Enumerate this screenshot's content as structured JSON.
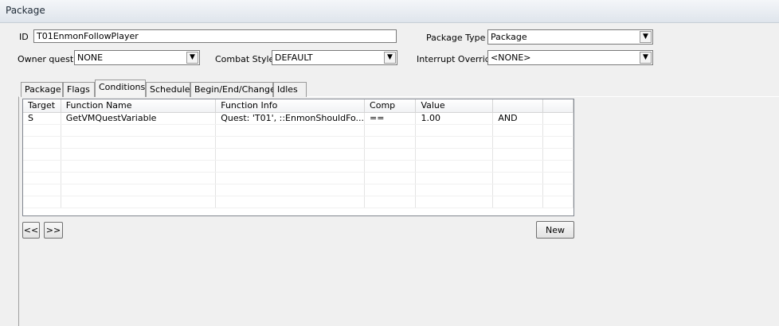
{
  "window": {
    "title": "Package"
  },
  "form": {
    "id_label": "ID",
    "id_value": "T01EnmonFollowPlayer",
    "owner_quest_label": "Owner quest",
    "owner_quest_value": "NONE",
    "combat_style_label": "Combat Style",
    "combat_style_value": "DEFAULT",
    "package_type_label": "Package Type",
    "package_type_value": "Package",
    "interrupt_override_label": "Interrupt Override",
    "interrupt_override_value": "<NONE>"
  },
  "tabs": [
    "Package",
    "Flags",
    "Conditions",
    "Schedule",
    "Begin/End/Change",
    "Idles"
  ],
  "active_tab": "Conditions",
  "conditions": {
    "columns": [
      "Target",
      "Function Name",
      "Function Info",
      "Comp",
      "Value",
      ""
    ],
    "rows": [
      [
        "S",
        "GetVMQuestVariable",
        "Quest: 'T01', ::EnmonShouldFo...",
        "==",
        "1.00",
        "AND"
      ]
    ]
  },
  "buttons": {
    "prev": "<<",
    "next": ">>",
    "new": "New"
  },
  "icons": {
    "dropdown": "chevron-down-icon"
  }
}
